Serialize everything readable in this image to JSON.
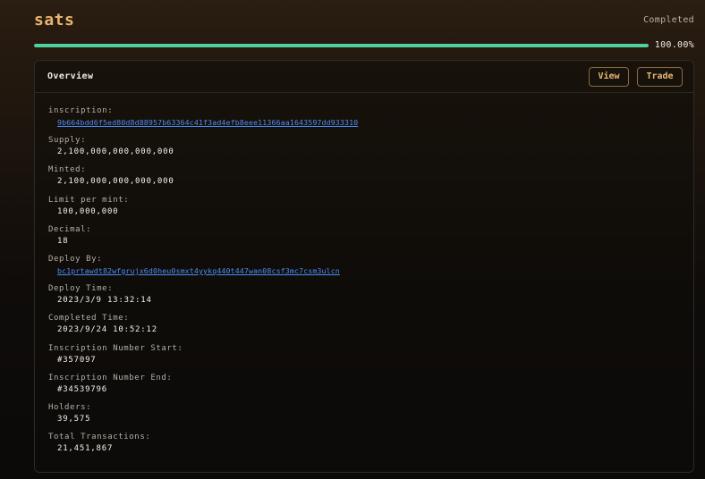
{
  "header": {
    "title": "sats",
    "status": "Completed"
  },
  "progress": {
    "fraction": 1.0,
    "label": "100.00%"
  },
  "card": {
    "title": "Overview",
    "view_label": "View",
    "trade_label": "Trade",
    "fields": [
      {
        "label": "inscription:",
        "value": "9b664bdd6f5ed80d8d88957b63364c41f3ad4efb8eee11366aa1643597dd933310",
        "link": true
      },
      {
        "label": "Supply:",
        "value": "2,100,000,000,000,000",
        "link": false
      },
      {
        "label": "Minted:",
        "value": "2,100,000,000,000,000",
        "link": false
      },
      {
        "label": "Limit per mint:",
        "value": "100,000,000",
        "link": false
      },
      {
        "label": "Decimal:",
        "value": "18",
        "link": false
      },
      {
        "label": "Deploy By:",
        "value": "bc1prtawdt82wfgrujx6d0heu0smxt4yykq440t447wan08csf3mc7csm3ulcn",
        "link": true
      },
      {
        "label": "Deploy Time:",
        "value": "2023/3/9 13:32:14",
        "link": false
      },
      {
        "label": "Completed Time:",
        "value": "2023/9/24 10:52:12",
        "link": false
      },
      {
        "label": "Inscription Number Start:",
        "value": "#357097",
        "link": false
      },
      {
        "label": "Inscription Number End:",
        "value": "#34539796",
        "link": false
      },
      {
        "label": "Holders:",
        "value": "39,575",
        "link": false
      },
      {
        "label": "Total Transactions:",
        "value": "21,451,867",
        "link": false
      }
    ]
  },
  "colors": {
    "accent": "#e7b46e",
    "progress": "#4fd1a1",
    "link": "#4d8df5"
  }
}
